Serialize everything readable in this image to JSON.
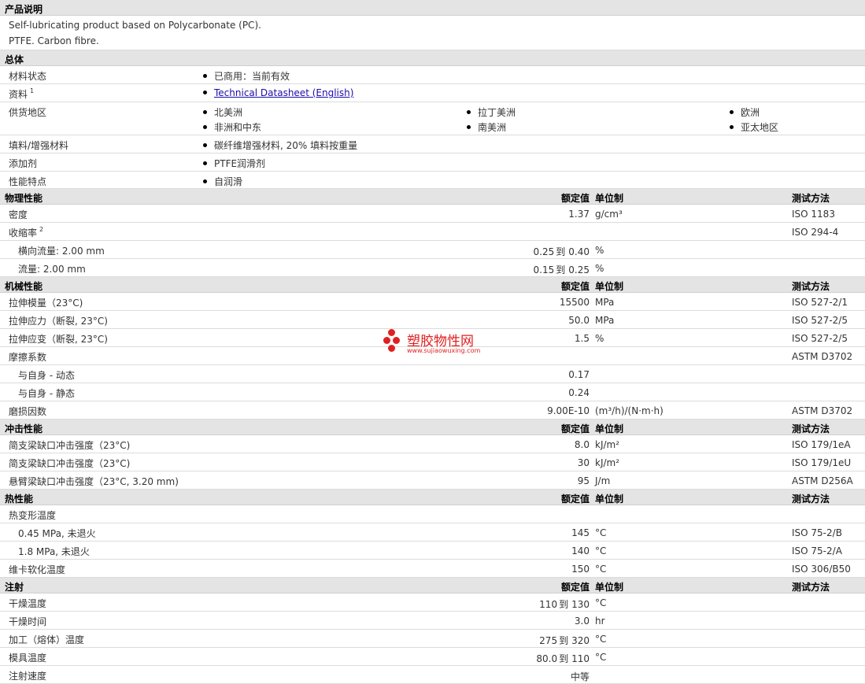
{
  "sections": {
    "desc": {
      "title": "产品说明",
      "line1": "Self-lubricating product based on Polycarbonate (PC).",
      "line2": "PTFE. Carbon fibre."
    },
    "general": {
      "title": "总体",
      "status_label": "材料状态",
      "status_value": "已商用：当前有效",
      "docs_label": "资料",
      "docs_sup": "1",
      "docs_link": "Technical Datasheet (English)",
      "regions_label": "供货地区",
      "regions": [
        "北美洲",
        "拉丁美洲",
        "欧洲",
        "非洲和中东",
        "南美洲",
        "亚太地区"
      ],
      "filler_label": "填料/增强材料",
      "filler_value": "碳纤维增强材料, 20% 填料按重量",
      "additive_label": "添加剂",
      "additive_value": "PTFE润滑剂",
      "feature_label": "性能特点",
      "feature_value": "自润滑"
    },
    "col_headers": {
      "value": "额定值",
      "unit": "单位制",
      "method": "测试方法"
    },
    "physical": {
      "title": "物理性能",
      "rows": [
        {
          "label": "密度",
          "value": "1.37",
          "unit": "g/cm³",
          "method": "ISO 1183"
        },
        {
          "label": "收缩率",
          "sup": "2",
          "method": "ISO 294-4"
        },
        {
          "label": "横向流量: 2.00 mm",
          "v1": "0.25",
          "to": "到",
          "v2": "0.40",
          "unit": "%"
        },
        {
          "label": "流量: 2.00 mm",
          "v1": "0.15",
          "to": "到",
          "v2": "0.25",
          "unit": "%"
        }
      ]
    },
    "mechanical": {
      "title": "机械性能",
      "rows": [
        {
          "label": "拉伸模量（23°C)",
          "value": "15500",
          "unit": "MPa",
          "method": "ISO 527-2/1"
        },
        {
          "label": "拉伸应力（断裂, 23°C)",
          "value": "50.0",
          "unit": "MPa",
          "method": "ISO 527-2/5"
        },
        {
          "label": "拉伸应变（断裂, 23°C)",
          "value": "1.5",
          "unit": "%",
          "method": "ISO 527-2/5"
        },
        {
          "label": "摩擦系数",
          "method": "ASTM D3702"
        },
        {
          "label": "与自身 - 动态",
          "value": "0.17"
        },
        {
          "label": "与自身 - 静态",
          "value": "0.24"
        },
        {
          "label": "磨损因数",
          "value": "9.00E-10",
          "unit": "(m³/h)/(N·m·h)",
          "method": "ASTM D3702"
        }
      ]
    },
    "impact": {
      "title": "冲击性能",
      "rows": [
        {
          "label": "简支梁缺口冲击强度（23°C)",
          "value": "8.0",
          "unit": "kJ/m²",
          "method": "ISO 179/1eA"
        },
        {
          "label": "简支梁缺口冲击强度（23°C)",
          "value": "30",
          "unit": "kJ/m²",
          "method": "ISO 179/1eU"
        },
        {
          "label": "悬臂梁缺口冲击强度（23°C, 3.20 mm)",
          "value": "95",
          "unit": "J/m",
          "method": "ASTM D256A"
        }
      ]
    },
    "thermal": {
      "title": "热性能",
      "rows": [
        {
          "label": "热变形温度"
        },
        {
          "label": "0.45 MPa, 未退火",
          "value": "145",
          "unit": "°C",
          "method": "ISO 75-2/B"
        },
        {
          "label": "1.8 MPa, 未退火",
          "value": "140",
          "unit": "°C",
          "method": "ISO 75-2/A"
        },
        {
          "label": "维卡软化温度",
          "value": "150",
          "unit": "°C",
          "method": "ISO 306/B50"
        }
      ]
    },
    "injection": {
      "title": "注射",
      "rows": [
        {
          "label": "干燥温度",
          "v1": "110",
          "to": "到",
          "v2": "130",
          "unit": "°C"
        },
        {
          "label": "干燥时间",
          "value": "3.0",
          "unit": "hr"
        },
        {
          "label": "加工（熔体）温度",
          "v1": "275",
          "to": "到",
          "v2": "320",
          "unit": "°C"
        },
        {
          "label": "模具温度",
          "v1": "80.0",
          "to": "到",
          "v2": "110",
          "unit": "°C"
        },
        {
          "label": "注射速度",
          "value": "中等"
        }
      ]
    }
  },
  "watermark": {
    "cn": "塑胶物性网",
    "en": "www.sujiaowuxing.com"
  }
}
